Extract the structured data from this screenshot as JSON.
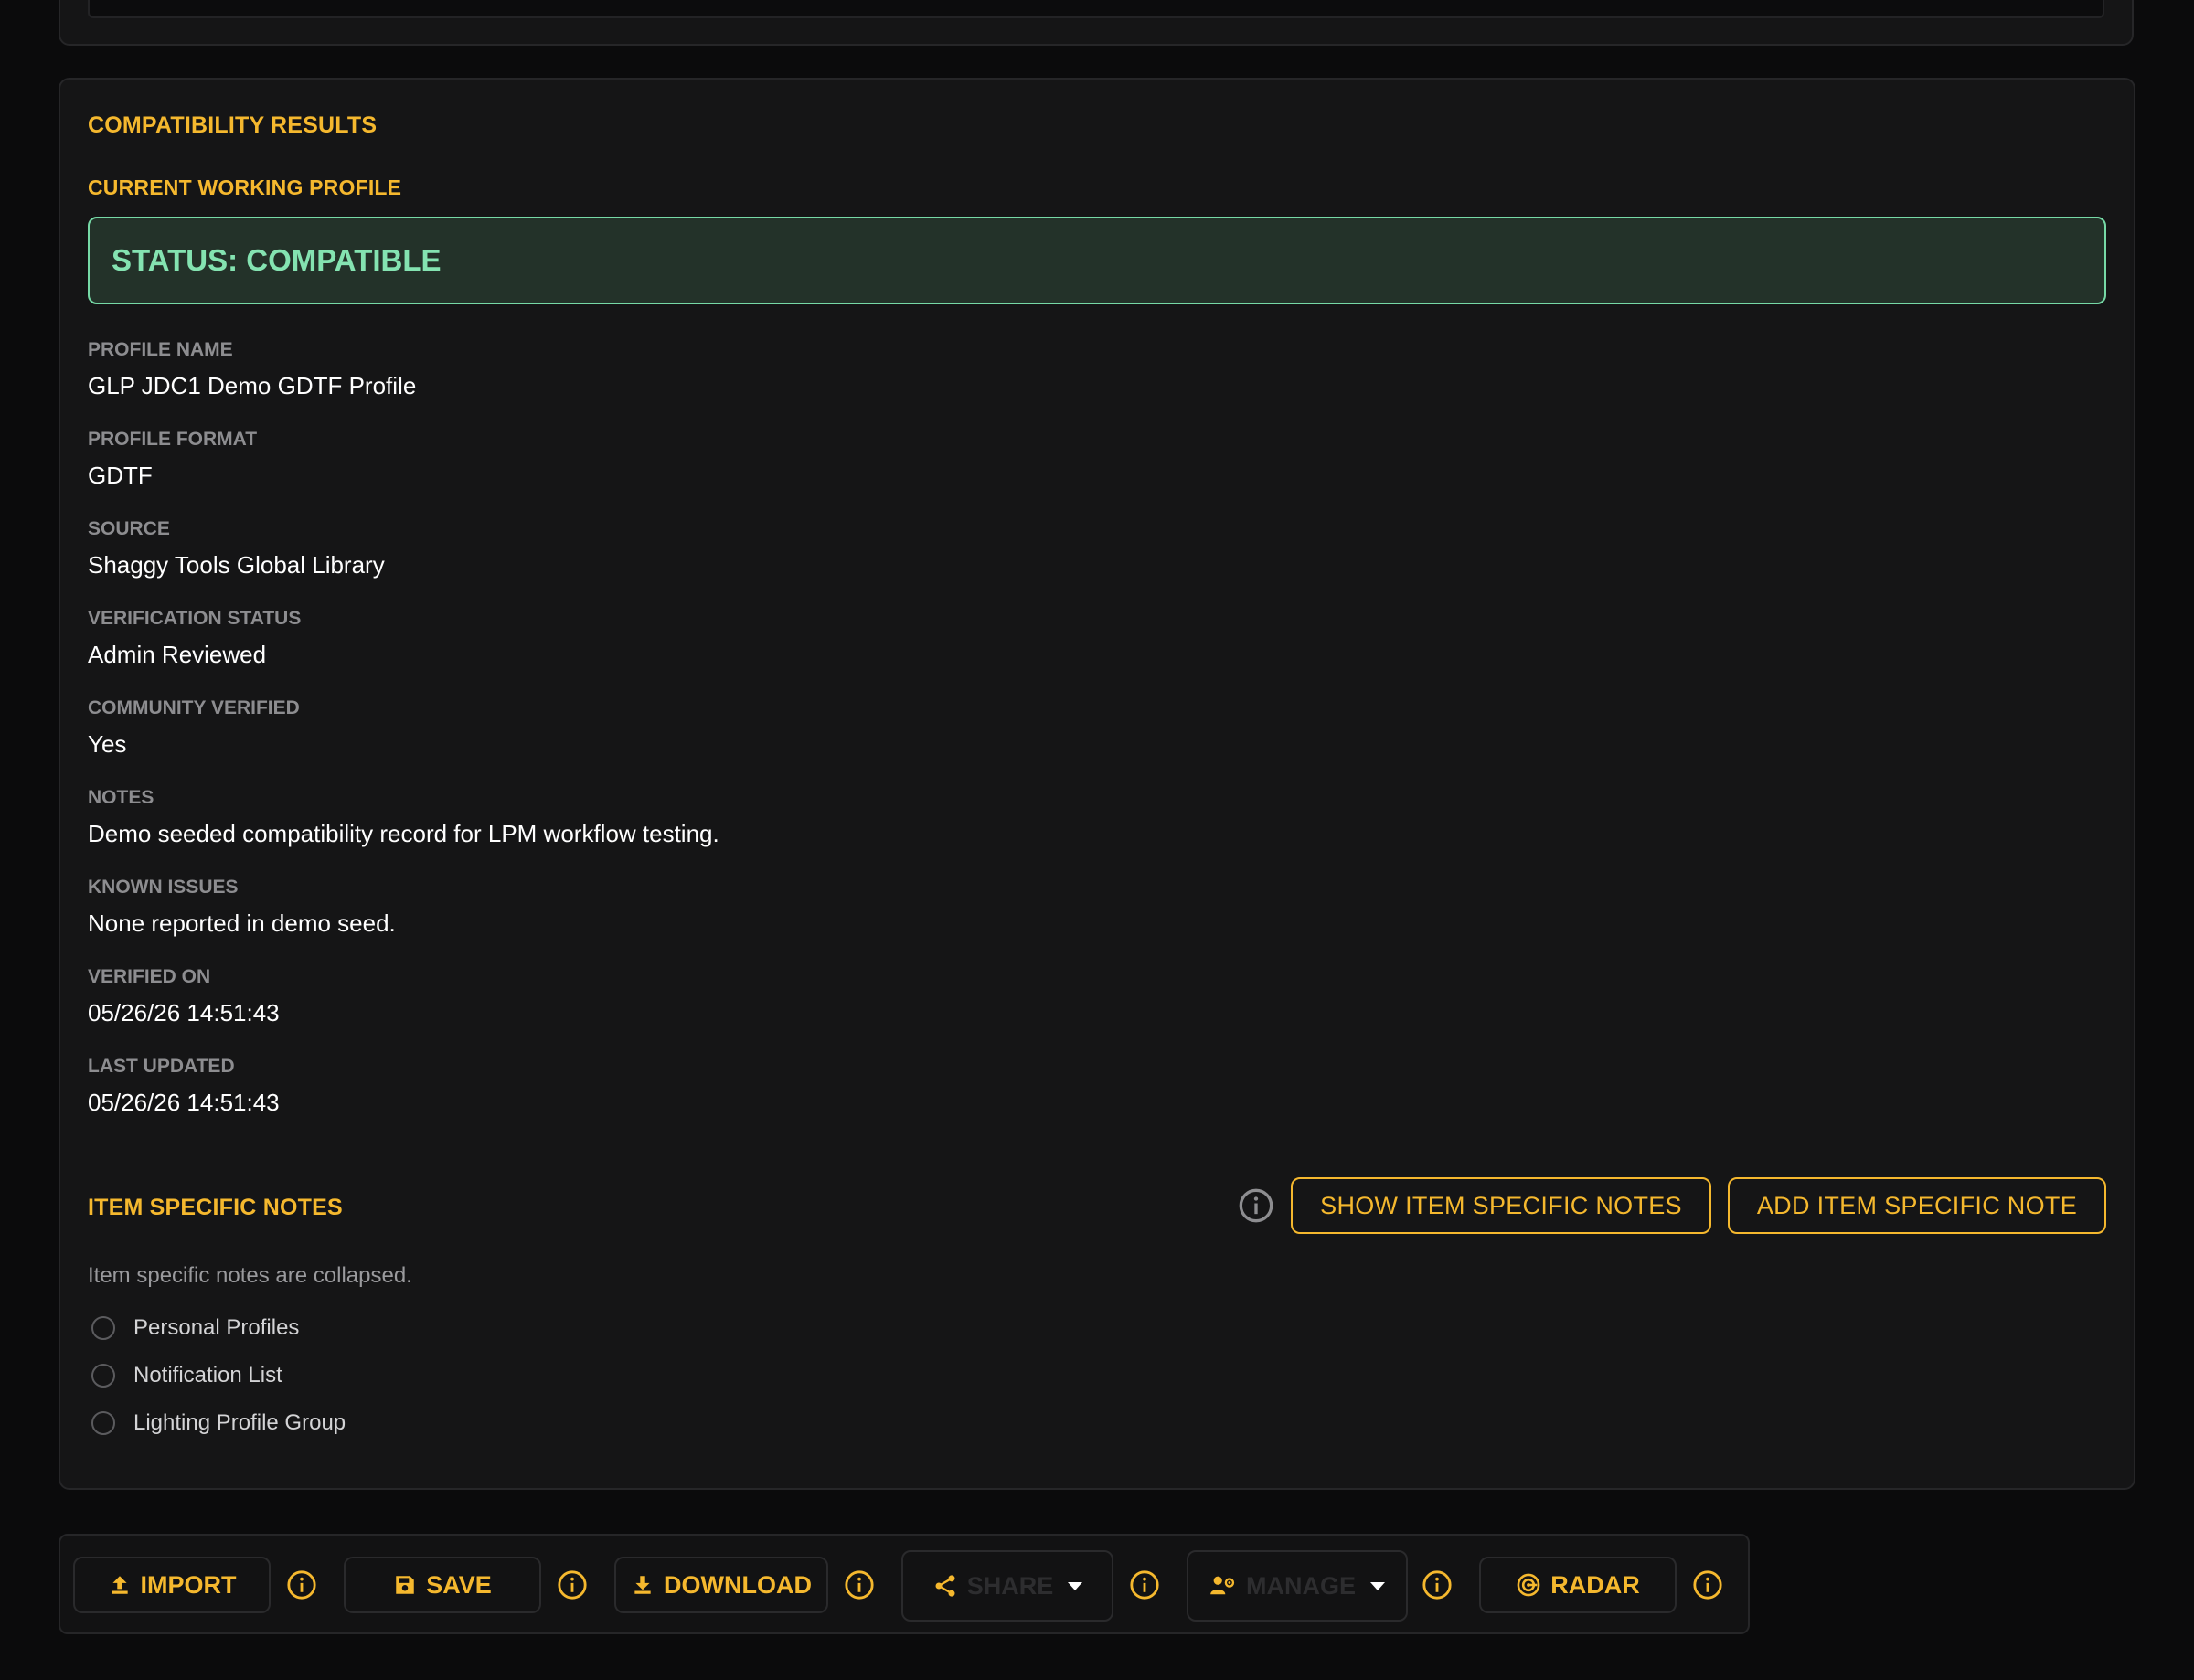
{
  "results": {
    "title": "COMPATIBILITY RESULTS",
    "current_profile_title": "CURRENT WORKING PROFILE",
    "status": "STATUS: COMPATIBLE",
    "fields": [
      {
        "label": "PROFILE NAME",
        "value": "GLP JDC1 Demo GDTF Profile"
      },
      {
        "label": "PROFILE FORMAT",
        "value": "GDTF"
      },
      {
        "label": "SOURCE",
        "value": "Shaggy Tools Global Library"
      },
      {
        "label": "VERIFICATION STATUS",
        "value": "Admin Reviewed"
      },
      {
        "label": "COMMUNITY VERIFIED",
        "value": "Yes"
      },
      {
        "label": "NOTES",
        "value": "Demo seeded compatibility record for LPM workflow testing."
      },
      {
        "label": "KNOWN ISSUES",
        "value": "None reported in demo seed."
      },
      {
        "label": "VERIFIED ON",
        "value": "05/26/26 14:51:43"
      },
      {
        "label": "LAST UPDATED",
        "value": "05/26/26 14:51:43"
      }
    ]
  },
  "item_notes": {
    "title": "ITEM SPECIFIC NOTES",
    "show_button": "SHOW ITEM SPECIFIC NOTES",
    "add_button": "ADD ITEM SPECIFIC NOTE",
    "collapsed_message": "Item specific notes are collapsed.",
    "options": [
      "Personal Profiles",
      "Notification List",
      "Lighting Profile Group"
    ]
  },
  "toolbar": {
    "import": "IMPORT",
    "save": "SAVE",
    "download": "DOWNLOAD",
    "share": "SHARE",
    "manage": "MANAGE",
    "radar": "RADAR"
  },
  "colors": {
    "accent": "#f5b82e",
    "status_green": "#84e3b1",
    "background": "#0b0b0c",
    "card": "#151516"
  },
  "icons": [
    "upload-icon",
    "save-icon",
    "download-icon",
    "share-icon",
    "manage-users-icon",
    "radar-icon",
    "info-icon"
  ]
}
